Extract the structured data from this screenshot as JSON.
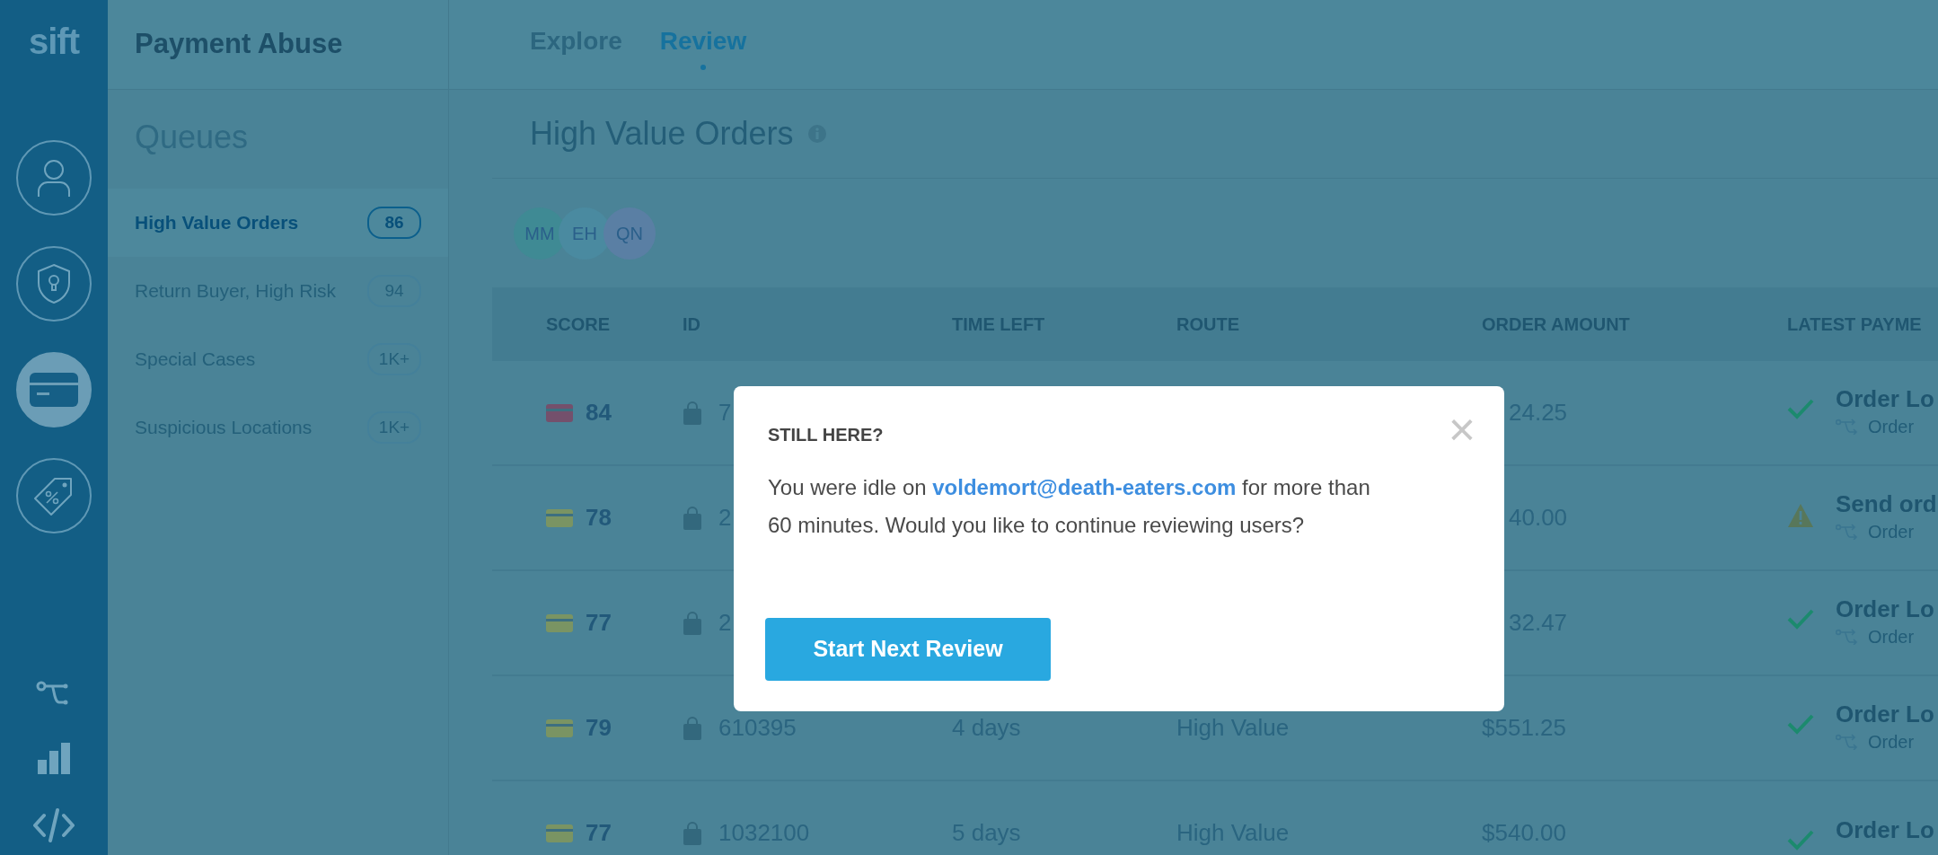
{
  "logo": "sift",
  "rail": {
    "items": [
      {
        "kind": "user",
        "selected": false
      },
      {
        "kind": "shield",
        "selected": false
      },
      {
        "kind": "card",
        "selected": true
      },
      {
        "kind": "tag",
        "selected": false
      }
    ],
    "tools": [
      {
        "kind": "branch"
      },
      {
        "kind": "chart"
      },
      {
        "kind": "code"
      }
    ]
  },
  "product": "Payment Abuse",
  "queues": {
    "title": "Queues",
    "items": [
      {
        "label": "High Value Orders",
        "count": "86",
        "selected": true
      },
      {
        "label": "Return Buyer, High Risk",
        "count": "94",
        "selected": false
      },
      {
        "label": "Special Cases",
        "count": "1K+",
        "selected": false
      },
      {
        "label": "Suspicious Locations",
        "count": "1K+",
        "selected": false
      }
    ]
  },
  "tabs": [
    {
      "label": "Explore",
      "selected": false
    },
    {
      "label": "Review",
      "selected": true
    }
  ],
  "page_title": "High Value Orders",
  "reviewers": [
    {
      "initials": "MM",
      "color": "#3f8a94"
    },
    {
      "initials": "EH",
      "color": "#4a8aa0"
    },
    {
      "initials": "QN",
      "color": "#5a7fa4"
    }
  ],
  "table": {
    "columns": [
      "SCORE",
      "ID",
      "TIME LEFT",
      "ROUTE",
      "ORDER AMOUNT",
      "LATEST PAYME"
    ],
    "rows": [
      {
        "score": "84",
        "color": "#74506c",
        "id": "7",
        "amount": "24.25",
        "covered": true,
        "kind": "ok",
        "event": "Order Lo",
        "detail": "Order"
      },
      {
        "score": "78",
        "color": "#7a9463",
        "id": "2",
        "amount": "40.00",
        "covered": true,
        "kind": "warning",
        "event": "Send ord",
        "detail": "Order"
      },
      {
        "score": "77",
        "color": "#7a9463",
        "id": "2",
        "amount": "32.47",
        "covered": true,
        "kind": "ok",
        "event": "Order Lo",
        "detail": "Order"
      },
      {
        "score": "79",
        "color": "#7a9463",
        "id": "610395",
        "time_left": "4 days",
        "route": "High Value",
        "amount": "$551.25",
        "covered": false,
        "kind": "ok",
        "event": "Order Lo",
        "detail": "Order"
      },
      {
        "score": "77",
        "color": "#7a9463",
        "id": "1032100",
        "time_left": "5 days",
        "route": "High Value",
        "amount": "$540.00",
        "covered": false,
        "kind": "ok",
        "event": "Order Lo"
      }
    ]
  },
  "dialog": {
    "title": "STILL HERE?",
    "close": "×",
    "message": {
      "before": "You were idle on",
      "link": "voldemort@death-eaters.com",
      "after": "for more than 60 minutes. Would you like to continue reviewing users?"
    },
    "button": "Start Next Review"
  }
}
